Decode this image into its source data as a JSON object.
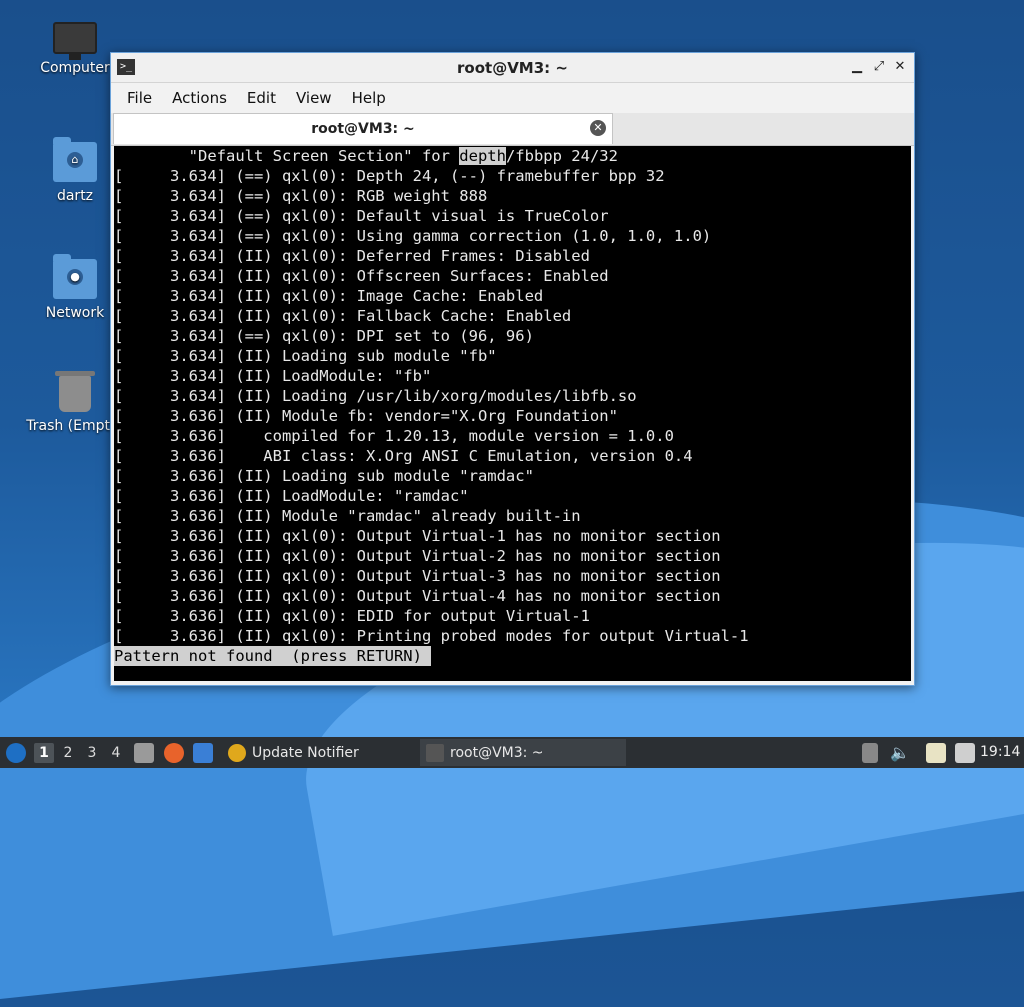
{
  "desktop": {
    "icons": [
      {
        "label": "Computer",
        "icon": "computer-icon"
      },
      {
        "label": "dartz",
        "icon": "home-folder-icon"
      },
      {
        "label": "Network",
        "icon": "network-folder-icon"
      },
      {
        "label": "Trash (Empty)",
        "icon": "trash-icon"
      }
    ]
  },
  "window": {
    "title": "root@VM3: ~",
    "menu": [
      "File",
      "Actions",
      "Edit",
      "View",
      "Help"
    ],
    "tab_label": "root@VM3: ~"
  },
  "terminal": {
    "first_line_before": "        \"Default Screen Section\" for ",
    "first_line_highlight": "depth",
    "first_line_after": "/fbbpp 24/32",
    "lines": [
      "[     3.634] (==) qxl(0): Depth 24, (--) framebuffer bpp 32",
      "[     3.634] (==) qxl(0): RGB weight 888",
      "[     3.634] (==) qxl(0): Default visual is TrueColor",
      "[     3.634] (==) qxl(0): Using gamma correction (1.0, 1.0, 1.0)",
      "[     3.634] (II) qxl(0): Deferred Frames: Disabled",
      "[     3.634] (II) qxl(0): Offscreen Surfaces: Enabled",
      "[     3.634] (II) qxl(0): Image Cache: Enabled",
      "[     3.634] (II) qxl(0): Fallback Cache: Enabled",
      "[     3.634] (==) qxl(0): DPI set to (96, 96)",
      "[     3.634] (II) Loading sub module \"fb\"",
      "[     3.634] (II) LoadModule: \"fb\"",
      "[     3.634] (II) Loading /usr/lib/xorg/modules/libfb.so",
      "[     3.636] (II) Module fb: vendor=\"X.Org Foundation\"",
      "[     3.636]    compiled for 1.20.13, module version = 1.0.0",
      "[     3.636]    ABI class: X.Org ANSI C Emulation, version 0.4",
      "[     3.636] (II) Loading sub module \"ramdac\"",
      "[     3.636] (II) LoadModule: \"ramdac\"",
      "[     3.636] (II) Module \"ramdac\" already built-in",
      "[     3.636] (II) qxl(0): Output Virtual-1 has no monitor section",
      "[     3.636] (II) qxl(0): Output Virtual-2 has no monitor section",
      "[     3.636] (II) qxl(0): Output Virtual-3 has no monitor section",
      "[     3.636] (II) qxl(0): Output Virtual-4 has no monitor section",
      "[     3.636] (II) qxl(0): EDID for output Virtual-1",
      "[     3.636] (II) qxl(0): Printing probed modes for output Virtual-1"
    ],
    "status": "Pattern not found  (press RETURN) "
  },
  "taskbar": {
    "workspaces": [
      "1",
      "2",
      "3",
      "4"
    ],
    "active_workspace": "1",
    "tasks": [
      {
        "label": "Update Notifier",
        "icon": "update-notifier-icon"
      },
      {
        "label": "root@VM3: ~",
        "icon": "terminal-icon"
      }
    ],
    "clock": "19:14"
  }
}
